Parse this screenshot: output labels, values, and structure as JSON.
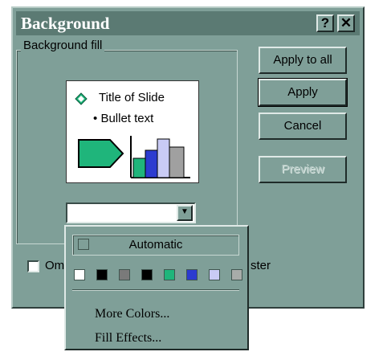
{
  "dialog": {
    "title": "Background",
    "help_label": "?",
    "close_label": "✕"
  },
  "fill_group": {
    "label": "Background fill"
  },
  "preview": {
    "slide_title": "Title of Slide",
    "bullet_text": "Bullet text",
    "bullet_char": "•",
    "arrow_color": "#1fb57b",
    "bar_colors": [
      "#1fb57b",
      "#2c3bd0",
      "#c9cbf5",
      "#a0a0a0"
    ]
  },
  "buttons": {
    "apply_to_all": "Apply to all",
    "apply": "Apply",
    "cancel": "Cancel",
    "preview": "Preview"
  },
  "combo": {
    "value": "",
    "arrow": "▼"
  },
  "omit_checkbox": {
    "label_start": "Om",
    "label_end": "ster",
    "checked": false
  },
  "color_menu": {
    "automatic_label": "Automatic",
    "swatches": [
      "#ffffff",
      "#000000",
      "#7a7a7a",
      "#000000",
      "#1fb57b",
      "#2c3bd0",
      "#c9cbf5",
      "#a8aca9"
    ],
    "more_colors": "More Colors...",
    "fill_effects": "Fill Effects..."
  },
  "colors": {
    "dialog_face": "#7f9f98",
    "title_bar": "#5b7a73"
  }
}
